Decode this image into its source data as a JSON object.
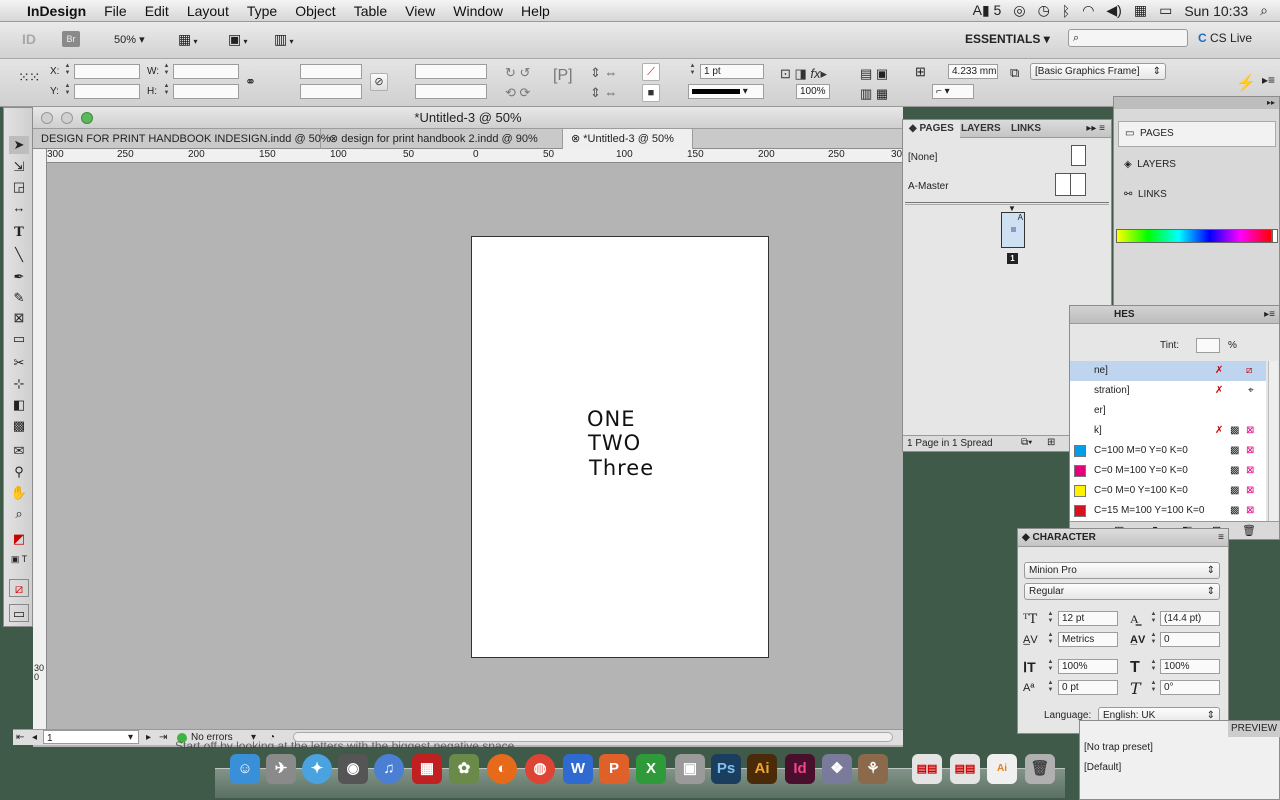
{
  "menubar": {
    "app_name": "InDesign",
    "items": [
      "File",
      "Edit",
      "Layout",
      "Type",
      "Object",
      "Table",
      "View",
      "Window",
      "Help"
    ],
    "status_ai": "5",
    "clock": "Sun 10:33"
  },
  "appbar": {
    "logo": "ID",
    "bridge": "Br",
    "zoom": "50%",
    "workspace": "ESSENTIALS",
    "cs_live": "CS Live"
  },
  "control": {
    "x_label": "X:",
    "y_label": "Y:",
    "w_label": "W:",
    "h_label": "H:",
    "stroke_weight": "1 pt",
    "opacity": "100%",
    "offset": "4.233 mm",
    "object_style": "[Basic Graphics Frame]"
  },
  "document": {
    "title": "*Untitled-3 @ 50%",
    "tabs": [
      {
        "label": "DESIGN FOR PRINT HANDBOOK INDESIGN.indd @ 50%",
        "active": false
      },
      {
        "label": "design for print handbook 2.indd @ 90%",
        "active": false
      },
      {
        "label": "*Untitled-3 @ 50%",
        "active": true
      }
    ],
    "ruler_labels": [
      "300",
      "250",
      "200",
      "150",
      "100",
      "50",
      "0",
      "50",
      "100",
      "150",
      "200",
      "250",
      "300"
    ],
    "vruler_label": "300",
    "page_text": [
      "ONE",
      "TWO",
      "Three"
    ],
    "page_number": "1",
    "errors": "No errors",
    "behind_text": "Start off by looking at the letters with the biggest negative space."
  },
  "pages_panel": {
    "tabs": [
      "PAGES",
      "LAYERS",
      "LINKS"
    ],
    "none_label": "[None]",
    "master_label": "A-Master",
    "thumb_letter": "A",
    "thumb_page": "1",
    "footer": "1 Page in 1 Spread"
  },
  "side_panel": {
    "items": [
      "PAGES",
      "LAYERS",
      "LINKS"
    ]
  },
  "swatches": {
    "title": "HES",
    "tint_label": "Tint:",
    "tint_unit": "%",
    "rows": [
      {
        "name": "ne]",
        "color": "#ffffff"
      },
      {
        "name": "stration]",
        "color": "#000000"
      },
      {
        "name": "er]",
        "color": "#ffffff"
      },
      {
        "name": "k]",
        "color": "#000000"
      },
      {
        "name": "C=100 M=0 Y=0 K=0",
        "color": "#00a0e9"
      },
      {
        "name": "C=0 M=100 Y=0 K=0",
        "color": "#e4007f"
      },
      {
        "name": "C=0 M=0 Y=100 K=0",
        "color": "#fff100"
      },
      {
        "name": "C=15 M=100 Y=100 K=0",
        "color": "#d7111f"
      }
    ]
  },
  "character": {
    "title": "CHARACTER",
    "font": "Minion Pro",
    "style": "Regular",
    "size": "12 pt",
    "leading": "(14.4 pt)",
    "kerning": "Metrics",
    "tracking": "0",
    "vscale": "100%",
    "hscale": "100%",
    "baseline": "0 pt",
    "skew": "0°",
    "language_label": "Language:",
    "language": "English: UK"
  },
  "trap": {
    "preview": "PREVIEW",
    "items": [
      "[No trap preset]",
      "[Default]"
    ]
  }
}
